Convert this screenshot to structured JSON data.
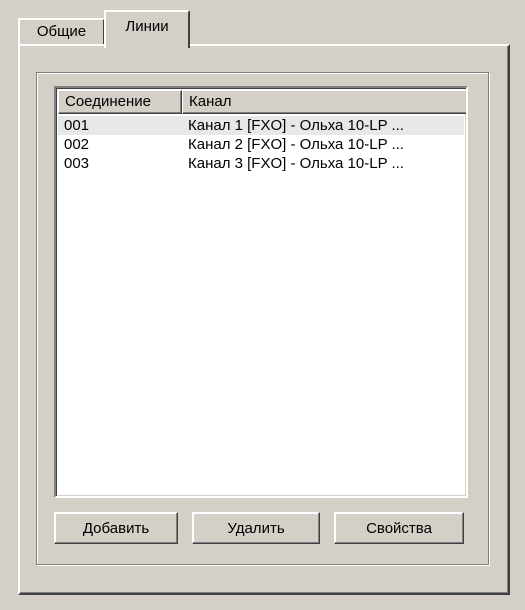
{
  "tabs": [
    {
      "label": "Общие",
      "active": false
    },
    {
      "label": "Линии",
      "active": true
    }
  ],
  "list": {
    "columns": [
      "Соединение",
      "Канал"
    ],
    "rows": [
      {
        "connection": "001",
        "channel": "Канал 1 [FXO] - Ольха 10-LP ...",
        "selected": true
      },
      {
        "connection": "002",
        "channel": "Канал 2 [FXO] - Ольха 10-LP ...",
        "selected": false
      },
      {
        "connection": "003",
        "channel": "Канал 3 [FXO] - Ольха 10-LP ...",
        "selected": false
      }
    ]
  },
  "buttons": {
    "add": "Добавить",
    "delete": "Удалить",
    "properties": "Свойства"
  },
  "colors": {
    "face": "#d4d0c8",
    "window": "#ffffff",
    "selected_row": "#e8e8e8"
  }
}
